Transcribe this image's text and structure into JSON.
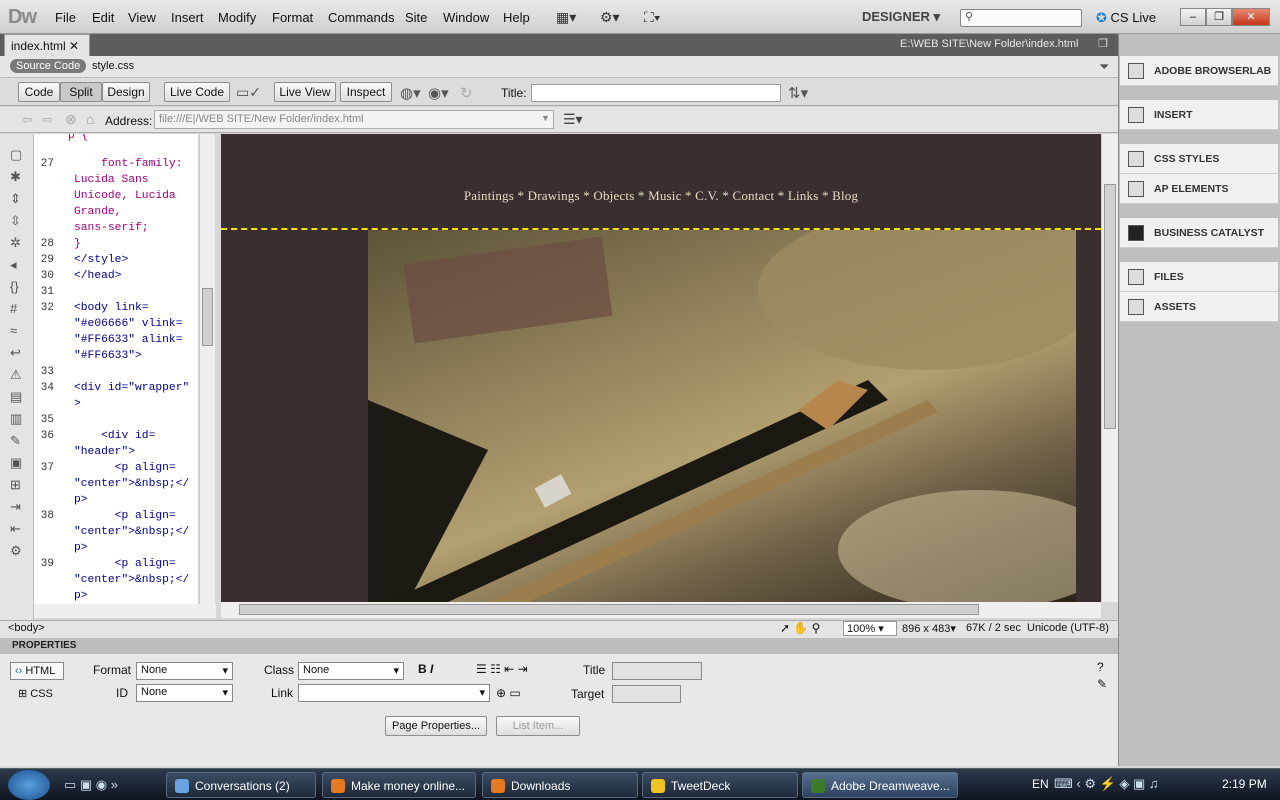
{
  "app": {
    "logo": "Dw",
    "menus": [
      "File",
      "Edit",
      "View",
      "Insert",
      "Modify",
      "Format",
      "Commands",
      "Site",
      "Window",
      "Help"
    ],
    "workspace": "DESIGNER",
    "cslive": "CS Live"
  },
  "doc": {
    "tab": "index.html",
    "path": "E:\\WEB SITE\\New Folder\\index.html",
    "source_code": "Source Code",
    "related": "style.css"
  },
  "toolbar": {
    "code": "Code",
    "split": "Split",
    "design": "Design",
    "live_code": "Live Code",
    "live_view": "Live View",
    "inspect": "Inspect",
    "title_label": "Title:",
    "title_value": ""
  },
  "address": {
    "label": "Address:",
    "value": "file:///E|/WEB SITE/New Folder/index.html"
  },
  "code": {
    "lines": [
      {
        "n": "27",
        "t": "    font-family:\nLucida Sans\nUnicode, Lucida\nGrande,\nsans-serif;"
      },
      {
        "n": "28",
        "t": "}"
      },
      {
        "n": "29",
        "t": "</style>"
      },
      {
        "n": "30",
        "t": "</head>"
      },
      {
        "n": "31",
        "t": ""
      },
      {
        "n": "32",
        "t": "<body link=\n\"#e06666\" vlink=\n\"#FF6633\" alink=\n\"#FF6633\">"
      },
      {
        "n": "33",
        "t": ""
      },
      {
        "n": "34",
        "t": "<div id=\"wrapper\"\n>"
      },
      {
        "n": "35",
        "t": ""
      },
      {
        "n": "36",
        "t": "    <div id=\n\"header\">"
      },
      {
        "n": "37",
        "t": "      <p align=\n\"center\">&nbsp;</\np>"
      },
      {
        "n": "38",
        "t": "      <p align=\n\"center\">&nbsp;</\np>"
      },
      {
        "n": "39",
        "t": "      <p align=\n\"center\">&nbsp;</\np>"
      }
    ],
    "top_partial": "p {"
  },
  "page": {
    "nav": "Paintings * Drawings * Objects *  Music *  C.V.  *  Contact  * Links  *  Blog"
  },
  "status": {
    "tag": "<body>",
    "zoom": "100%",
    "size": "896 x 483",
    "weight": "67K / 2 sec",
    "encoding": "Unicode (UTF-8)"
  },
  "properties": {
    "header": "PROPERTIES",
    "html": "HTML",
    "css": "CSS",
    "format_label": "Format",
    "format_value": "None",
    "id_label": "ID",
    "id_value": "None",
    "class_label": "Class",
    "class_value": "None",
    "link_label": "Link",
    "title_label": "Title",
    "target_label": "Target",
    "page_props": "Page Properties...",
    "list_item": "List Item..."
  },
  "panels": [
    "ADOBE BROWSERLAB",
    "INSERT",
    "CSS STYLES",
    "AP ELEMENTS",
    "BUSINESS CATALYST",
    "FILES",
    "ASSETS"
  ],
  "taskbar": {
    "items": [
      "Conversations (2)",
      "Make money online...",
      "Downloads",
      "TweetDeck",
      "Adobe Dreamweave..."
    ],
    "lang": "EN",
    "clock": "2:19 PM"
  }
}
